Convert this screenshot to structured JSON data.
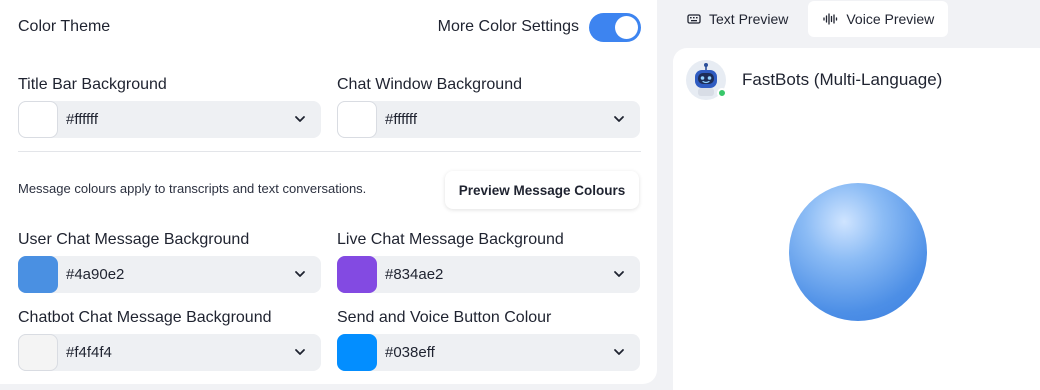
{
  "settings": {
    "title": "Color Theme",
    "more_settings_label": "More Color Settings",
    "more_settings_enabled": true,
    "fields_top": [
      {
        "label": "Title Bar Background",
        "value": "#ffffff",
        "swatch": "#ffffff"
      },
      {
        "label": "Chat Window Background",
        "value": "#ffffff",
        "swatch": "#ffffff"
      }
    ],
    "message_note": "Message colours apply to transcripts and text conversations.",
    "preview_button_label": "Preview Message Colours",
    "fields_message": [
      {
        "label": "User Chat Message Background",
        "value": "#4a90e2",
        "swatch": "#4a90e2"
      },
      {
        "label": "Live Chat Message Background",
        "value": "#834ae2",
        "swatch": "#834ae2"
      },
      {
        "label": "Chatbot Chat Message Background",
        "value": "#f4f4f4",
        "swatch": "#f4f4f4"
      },
      {
        "label": "Send and Voice Button Colour",
        "value": "#038eff",
        "swatch": "#038eff"
      }
    ]
  },
  "preview": {
    "tabs": [
      {
        "label": "Text Preview",
        "icon": "keyboard-icon",
        "active": false
      },
      {
        "label": "Voice Preview",
        "icon": "audio-waveform-icon",
        "active": true
      }
    ],
    "bot_name": "FastBots (Multi-Language)",
    "bot_status_color": "#38c76a"
  },
  "colors": {
    "accent": "#3d84f0",
    "panel_bg": "#ffffff",
    "page_bg": "#f1f2f5"
  }
}
